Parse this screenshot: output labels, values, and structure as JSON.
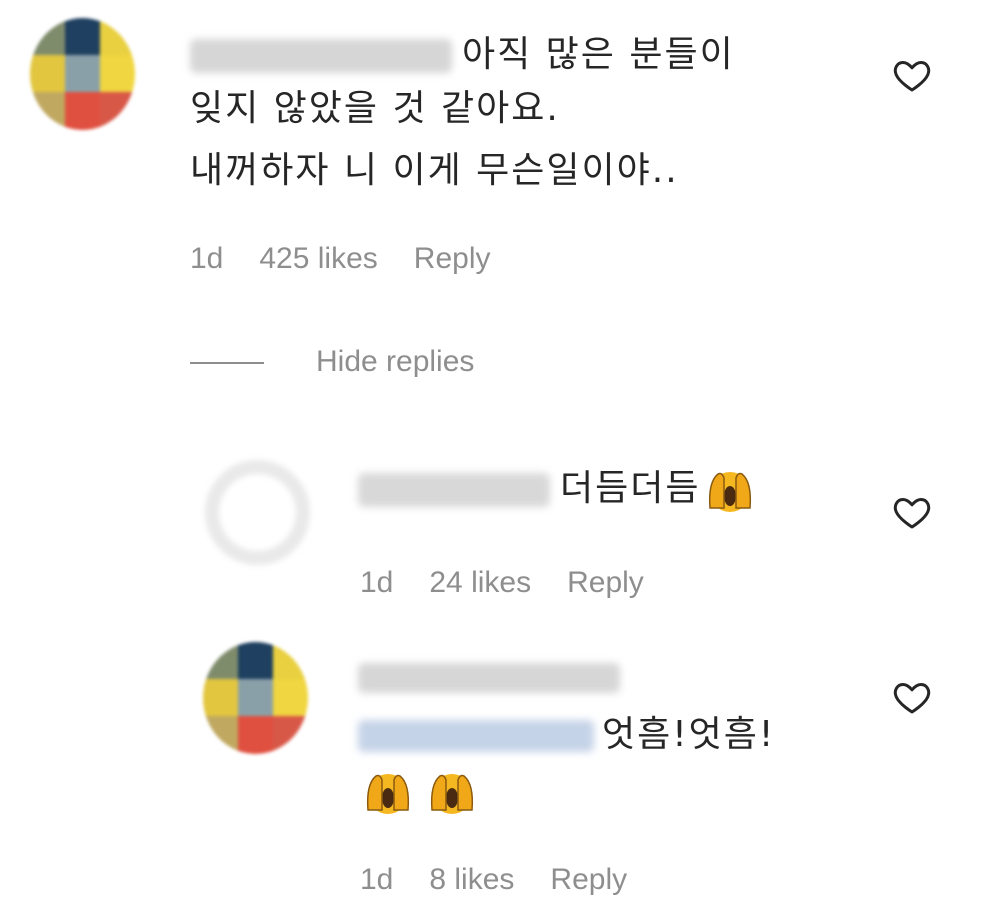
{
  "comments": [
    {
      "id": "c1",
      "text_line1": "아직 많은 분들이",
      "text_line2": "잊지 않았을 것 같아요.",
      "text_line3": "내꺼하자 니 이게 무슨일이야..",
      "time": "1d",
      "likes": "425 likes",
      "reply": "Reply"
    }
  ],
  "hide_replies": "Hide replies",
  "replies": [
    {
      "id": "r1",
      "text": "더듬더듬",
      "emoji": "fearful-face-hands",
      "time": "1d",
      "likes": "24 likes",
      "reply": "Reply"
    },
    {
      "id": "r2",
      "text": "엇흠!엇흠!",
      "emoji": "fearful-face-hands",
      "time": "1d",
      "likes": "8 likes",
      "reply": "Reply"
    }
  ],
  "colors": {
    "text": "#262626",
    "meta": "#8e8e8e",
    "mention": "#c5d3e8"
  }
}
